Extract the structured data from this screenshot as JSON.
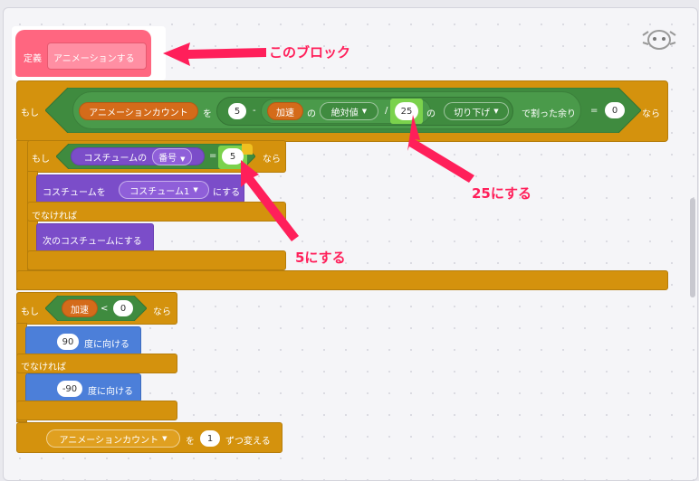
{
  "define_block": {
    "keyword": "定義",
    "name": "アニメーションする"
  },
  "outer_if": {
    "if_label": "もし",
    "then_label": "なら",
    "variable": "アニメーションカウント",
    "o_label": "を",
    "num1": "5",
    "minus": "-",
    "var_speed": "加速",
    "no_label1": "の",
    "abs_menu": "絶対値",
    "slash": "/",
    "num25": "25",
    "no_label2": "の",
    "floor_menu": "切り下げ",
    "mod_label": "で割った余り",
    "equals": "=",
    "num0": "0"
  },
  "inner_if": {
    "if_label": "もし",
    "costume_label": "コスチュームの",
    "costume_menu": "番号",
    "equals": "=",
    "num5": "5",
    "then_label": "なら",
    "set_costume_prefix": "コスチュームを",
    "costume_value": "コスチューム1",
    "set_costume_suffix": "にする",
    "else_label": "でなければ",
    "next_costume": "次のコスチュームにする"
  },
  "dir_if": {
    "if_label": "もし",
    "var_speed": "加速",
    "lt": "<",
    "num0": "0",
    "then_label": "なら",
    "dir1": "90",
    "point_label": "度に向ける",
    "else_label": "でなければ",
    "dir2": "-90"
  },
  "change_block": {
    "variable": "アニメーションカウント",
    "o_label": "を",
    "value": "1",
    "suffix": "ずつ変える"
  },
  "annotations": {
    "this_block": "このブロック",
    "set25": "25にする",
    "set5": "5にする"
  },
  "colors": {
    "control": "#d4920d",
    "operator": "#3f8b3f",
    "looks": "#7b4dc9",
    "motion": "#4c7fd9",
    "variable": "#d46b1a",
    "define": "#ff6680",
    "annotation": "#ff1f5a"
  }
}
